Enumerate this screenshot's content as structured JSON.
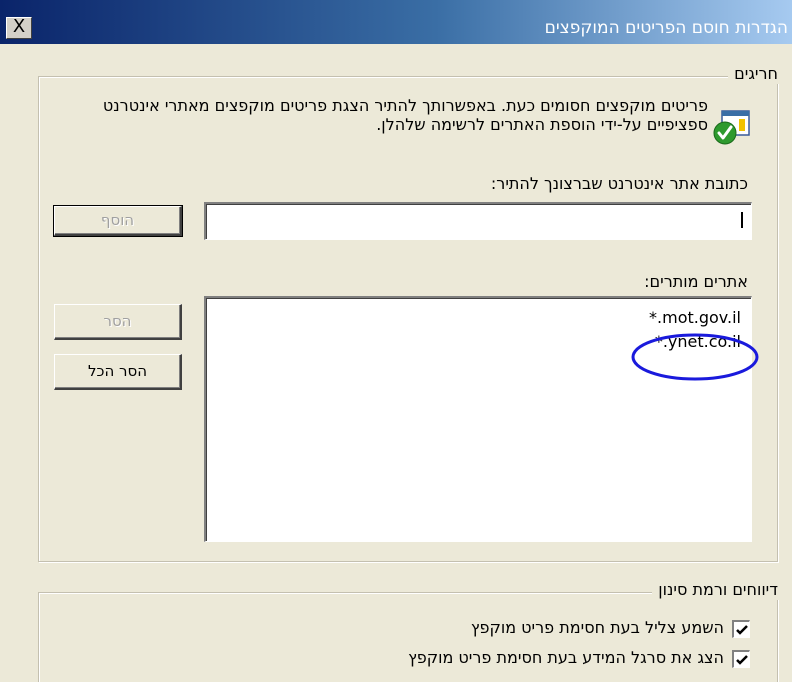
{
  "window": {
    "title": "הגדרות חוסם הפריטים המוקפצים",
    "close_glyph": "X"
  },
  "exceptions_group": {
    "legend": "חריגים",
    "info_text": "פריטים מוקפצים חסומים כעת. באפשרותך להתיר הצגת פריטים מוקפצים מאתרי אינטרנט ספציפיים על-ידי הוספת האתרים לרשימה שלהלן.",
    "info_icon": "shield-check-icon",
    "address_label": "כתובת אתר אינטרנט שברצונך להתיר:",
    "address_value": "",
    "add_button": "הוסף",
    "allowed_label": "אתרים מותרים:",
    "allowed_sites": [
      "*.mot.gov.il",
      "*.ynet.co.il"
    ],
    "remove_button": "הסר",
    "remove_all_button": "הסר הכל",
    "highlight_color": "#1a1adc"
  },
  "notifications_group": {
    "legend": "דיווחים ורמת סינון",
    "options": [
      {
        "label": "השמע צליל בעת חסימת פריט מוקפץ",
        "checked": true
      },
      {
        "label": "הצג את סרגל המידע בעת חסימת פריט מוקפץ",
        "checked": true
      }
    ]
  }
}
